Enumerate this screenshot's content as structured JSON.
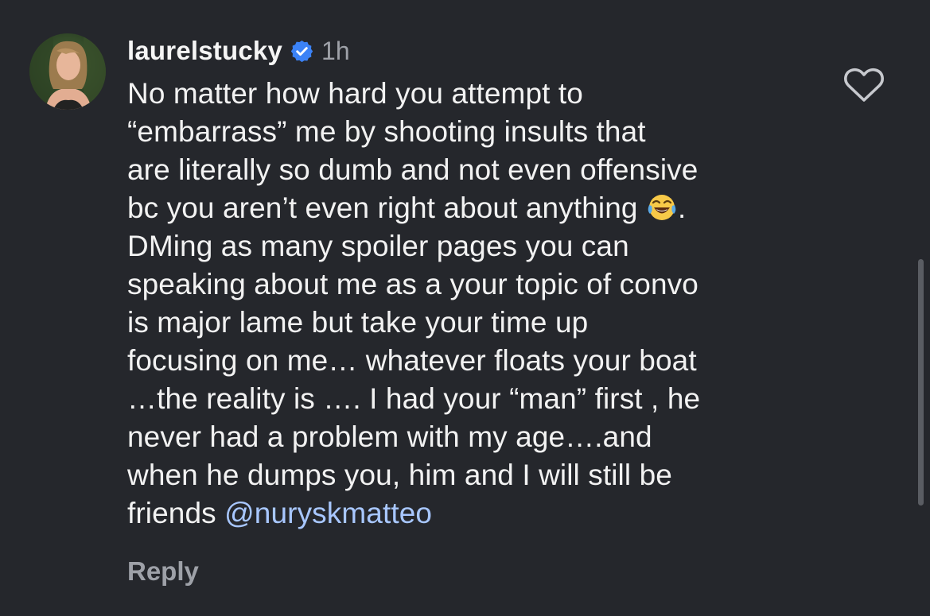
{
  "comment": {
    "username": "laurelstucky",
    "verified_icon": "verified-badge-icon",
    "timestamp": "1h",
    "text_before_emoji": "No matter how hard you attempt to\n“embarrass” me by shooting insults that\nare literally so dumb and not even offensive\nbc you aren’t even right about anything ",
    "emoji": "😂",
    "text_after_emoji": ".\nDMing as many spoiler pages you can\nspeaking about me as a your topic of convo\nis major lame but take your time up\nfocusing on me… whatever floats your boat\n…the reality is …. I had your “man” first , he\nnever had a problem with my age….and\nwhen he dumps you, him and I will still be\nfriends ",
    "mention": "@nuryskmatteo",
    "reply_label": "Reply",
    "like_icon": "heart-outline-icon"
  },
  "colors": {
    "background": "#25272c",
    "text": "#f2f2f2",
    "secondary_text": "#9ea1a8",
    "mention": "#a8c7ff",
    "verified": "#3b82f6"
  }
}
